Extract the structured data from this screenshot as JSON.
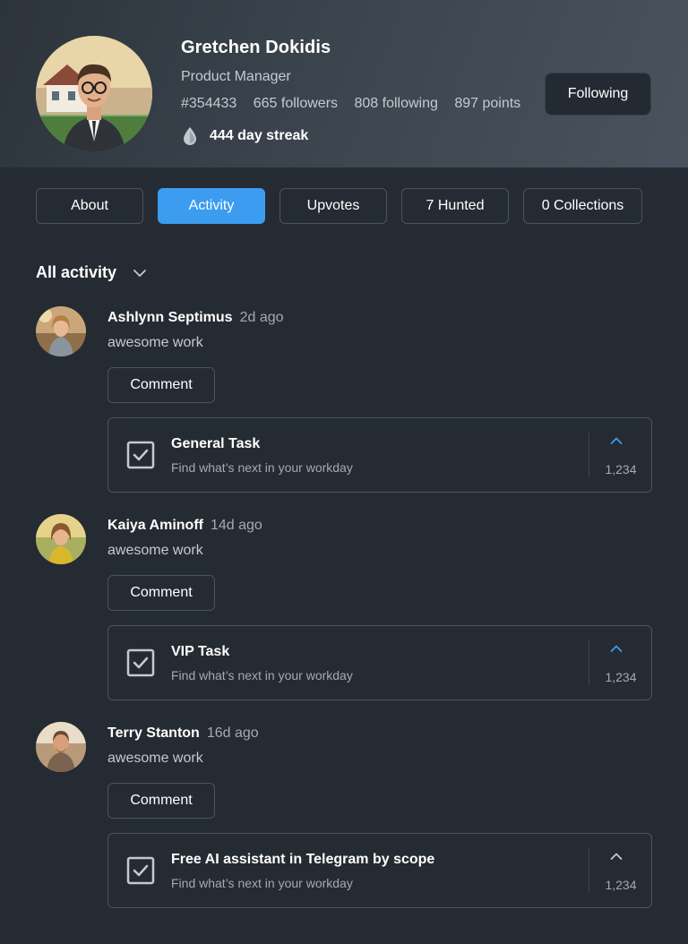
{
  "profile": {
    "name": "Gretchen Dokidis",
    "role": "Product Manager",
    "id": "#354433",
    "followers": "665 followers",
    "following": "808 following",
    "points": "897 points",
    "streak": "444 day streak",
    "follow_button": "Following"
  },
  "tabs": [
    {
      "label": "About",
      "active": false
    },
    {
      "label": "Activity",
      "active": true
    },
    {
      "label": "Upvotes",
      "active": false
    },
    {
      "label": "7 Hunted",
      "active": false
    },
    {
      "label": "0 Collections",
      "active": false
    }
  ],
  "filter": {
    "label": "All activity"
  },
  "activity": [
    {
      "author": "Ashlynn Septimus",
      "time": "2d ago",
      "message": "awesome work",
      "comment_label": "Comment",
      "card": {
        "title": "General Task",
        "subtitle": "Find what’s next in your workday",
        "votes": "1,234",
        "upvoted": true
      }
    },
    {
      "author": "Kaiya Aminoff",
      "time": "14d ago",
      "message": "awesome work",
      "comment_label": "Comment",
      "card": {
        "title": "VIP Task",
        "subtitle": "Find what’s next in your workday",
        "votes": "1,234",
        "upvoted": true
      }
    },
    {
      "author": "Terry Stanton",
      "time": "16d ago",
      "message": "awesome work",
      "comment_label": "Comment",
      "card": {
        "title": "Free AI assistant in Telegram by scope",
        "subtitle": "Find what’s next in your workday",
        "votes": "1,234",
        "upvoted": false
      }
    }
  ],
  "icons": {
    "streak": "drop-icon",
    "filter": "chevron-down-icon",
    "card": "checkbox-icon",
    "upvote": "chevron-up-icon"
  },
  "colors": {
    "accent": "#3b9cf0",
    "background": "#252b32",
    "upvoted": "#3b9cf0",
    "not_upvoted": "#c5cad1"
  }
}
